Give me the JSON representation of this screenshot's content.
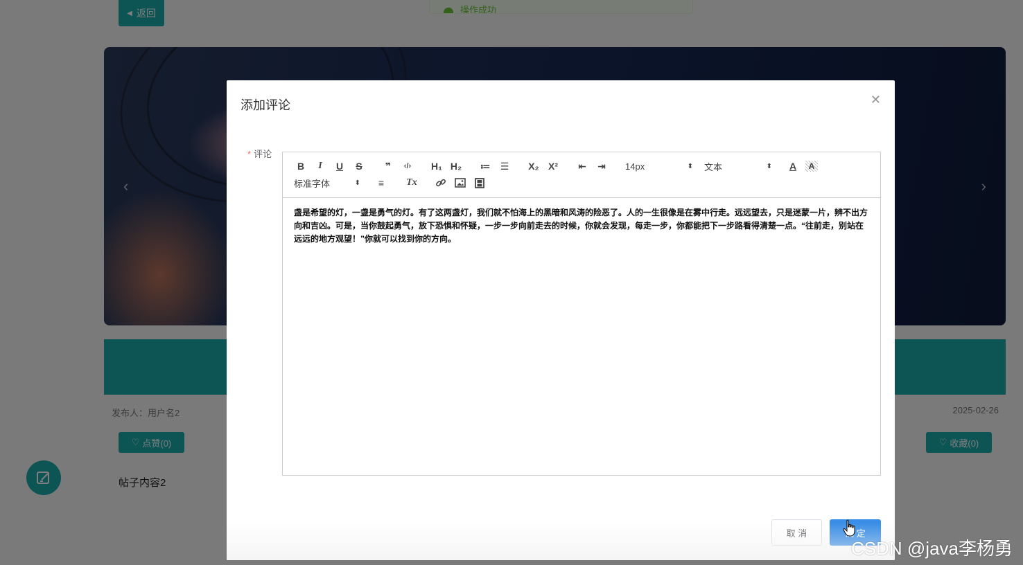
{
  "page": {
    "back_label": "返回",
    "toast_text": "操作成功",
    "author": "发布人：用户名2",
    "date": "2025-02-26",
    "like_label": "点赞(0)",
    "fav_label": "收藏(0)",
    "post_content": "帖子内容2",
    "theme_color": "#1aa8aa"
  },
  "dialog": {
    "title": "添加评论",
    "close_icon": "close-icon",
    "field_label": "评论",
    "required_mark": "*",
    "cancel_label": "取 消",
    "ok_label": "确 定",
    "primary_color": "#3a8ee6"
  },
  "editor": {
    "toolbar": {
      "bold": "B",
      "italic": "I",
      "underline": "U",
      "strike": "S",
      "quote": "❞",
      "code": "‹/›",
      "h1": "H₁",
      "h2": "H₂",
      "ordered_list": "≔",
      "bullet_list": "☰",
      "subscript": "X₂",
      "superscript": "X²",
      "outdent": "⇤",
      "indent": "⇥",
      "size_value": "14px",
      "header_value": "文本",
      "font_color_label": "A",
      "bg_color_label": "A",
      "font_value": "标准字体",
      "align": "≡",
      "clean": "Tx",
      "link_icon": "link-icon",
      "image_icon": "image-icon",
      "video_icon": "video-icon"
    },
    "content": "盏是希望的灯，一盏是勇气的灯。有了这两盏灯，我们就不怕海上的黑暗和风涛的险恶了。人的一生很像是在雾中行走。远远望去，只是迷蒙一片，辨不出方向和吉凶。可是，当你鼓起勇气，放下恐惧和怀疑，一步一步向前走去的时候，你就会发现，每走一步，你都能把下一步路看得清楚一点。“往前走，别站在远远的地方观望！”你就可以找到你的方向。"
  },
  "watermark": "CSDN @java李杨勇"
}
